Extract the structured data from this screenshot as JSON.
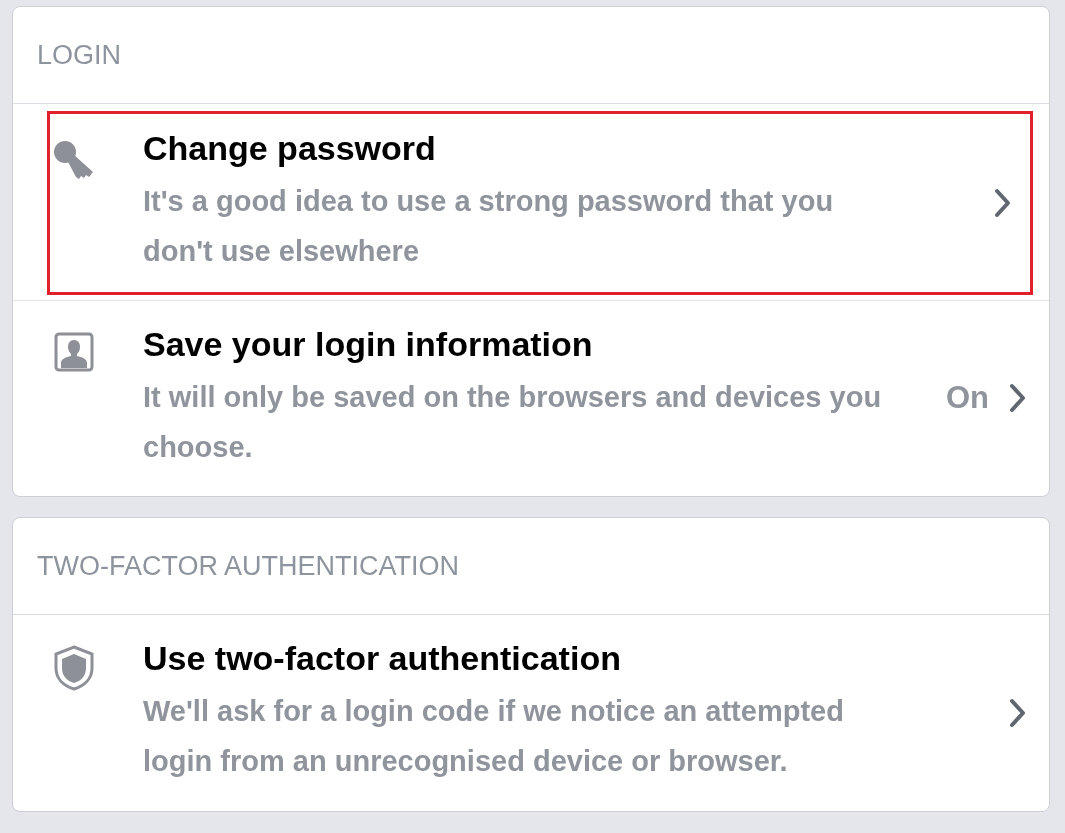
{
  "sections": [
    {
      "title": "LOGIN",
      "items": [
        {
          "kind": "key",
          "title": "Change password",
          "description": "It's a good idea to use a strong password that you don't use elsewhere",
          "highlighted": true
        },
        {
          "kind": "person",
          "title": "Save your login information",
          "description": "It will only be saved on the browsers and devices you choose.",
          "status": "On",
          "highlighted": false
        }
      ]
    },
    {
      "title": "TWO-FACTOR AUTHENTICATION",
      "items": [
        {
          "kind": "shield",
          "title": "Use two-factor authentication",
          "description": "We'll ask for a login code if we notice an attempted login from an unrecognised device or browser.",
          "highlighted": false
        }
      ]
    }
  ]
}
